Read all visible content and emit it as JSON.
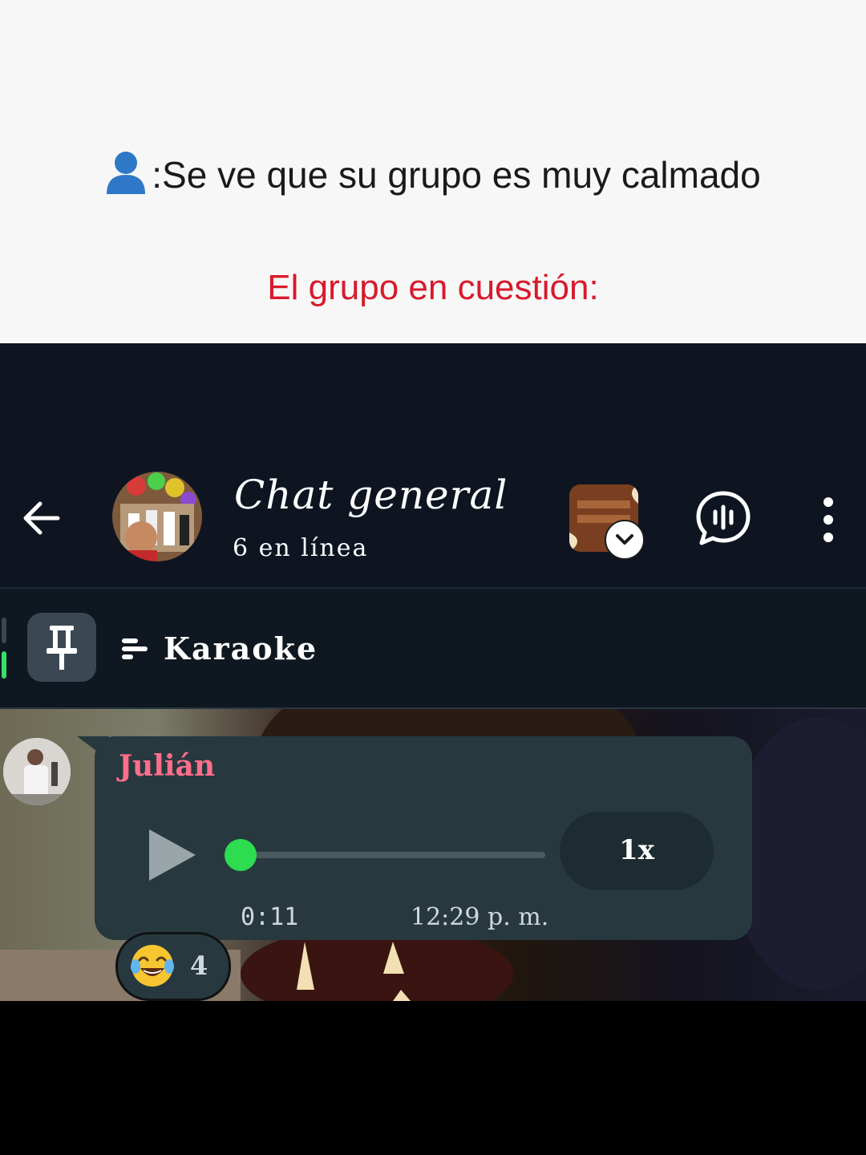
{
  "caption": {
    "line1": ":Se ve que su grupo es muy calmado",
    "line2": "El grupo en cuestión:",
    "icon": "person-silhouette-icon",
    "line2_color": "#d81a2c"
  },
  "chat_header": {
    "title": "Chat general",
    "online_status": "6 en línea",
    "icons": [
      "back-arrow-icon",
      "group-avatar",
      "prop-chest-icon",
      "voice-chat-icon",
      "more-options-icon"
    ]
  },
  "pinned": {
    "label": "Karaoke",
    "icons": [
      "pin-icon",
      "align-left-icon"
    ]
  },
  "message": {
    "sender": "Julián",
    "sender_color": "#ff6e8a",
    "type": "voice",
    "duration": "0:11",
    "timestamp": "12:29 p. m.",
    "playback_speed": "1x",
    "progress": 0.0,
    "progress_color": "#2ddc4f",
    "reaction": {
      "emoji": "tears-of-joy",
      "count": "4"
    }
  }
}
